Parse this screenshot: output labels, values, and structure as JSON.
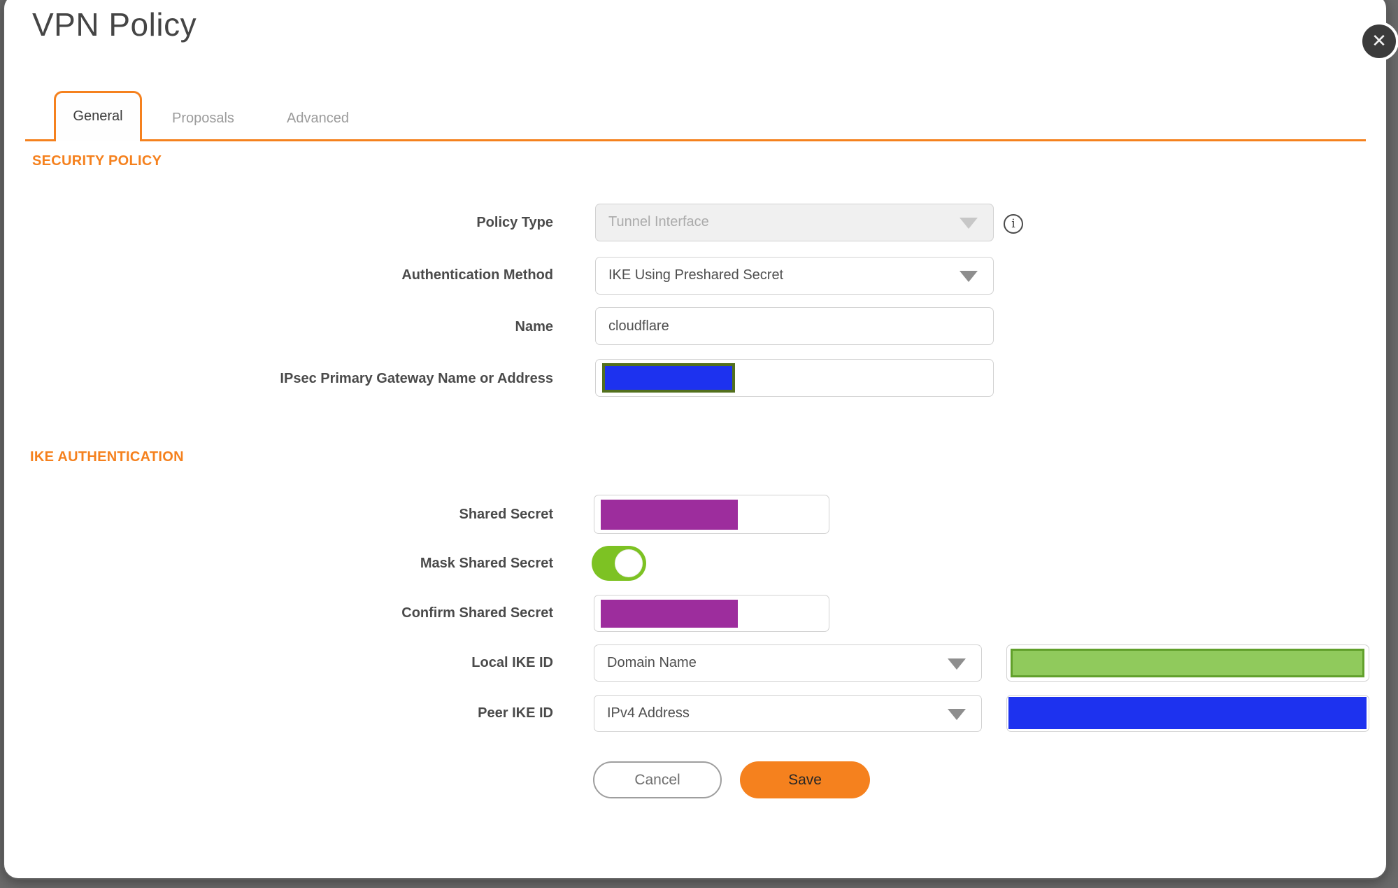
{
  "colors": {
    "orange": "#F5811E",
    "purple": "#9D2D9D",
    "blue": "#1D32EF",
    "olive": "#53701E",
    "greenfill": "#90CA5C",
    "greenborder": "#61A02B",
    "togglegreen": "#7DC223",
    "pagebg": "#6A6A6A",
    "closebg": "#3B3B3B"
  },
  "dialog": {
    "title": "VPN Policy",
    "close_label": "✕"
  },
  "tabs": [
    {
      "label": "General",
      "active": true
    },
    {
      "label": "Proposals",
      "active": false
    },
    {
      "label": "Advanced",
      "active": false
    }
  ],
  "security_policy": {
    "heading": "SECURITY POLICY",
    "policy_type": {
      "label": "Policy Type",
      "value": "Tunnel Interface",
      "disabled": true
    },
    "auth_method": {
      "label": "Authentication Method",
      "value": "IKE Using Preshared Secret"
    },
    "name": {
      "label": "Name",
      "value": "cloudflare"
    },
    "gateway": {
      "label": "IPsec Primary Gateway Name or Address",
      "value": "",
      "redacted": "blue"
    }
  },
  "ike_authentication": {
    "heading": "IKE AUTHENTICATION",
    "shared_secret": {
      "label": "Shared Secret",
      "redacted": "purple"
    },
    "mask_shared_secret": {
      "label": "Mask Shared Secret",
      "state": "on"
    },
    "confirm_shared_secret": {
      "label": "Confirm Shared Secret",
      "redacted": "purple"
    },
    "local_ike_id": {
      "label": "Local IKE ID",
      "value": "Domain Name",
      "redacted": "green"
    },
    "peer_ike_id": {
      "label": "Peer IKE ID",
      "value": "IPv4 Address",
      "redacted": "blue"
    }
  },
  "footer": {
    "cancel_label": "Cancel",
    "save_label": "Save"
  },
  "info_icon_glyph": "i"
}
